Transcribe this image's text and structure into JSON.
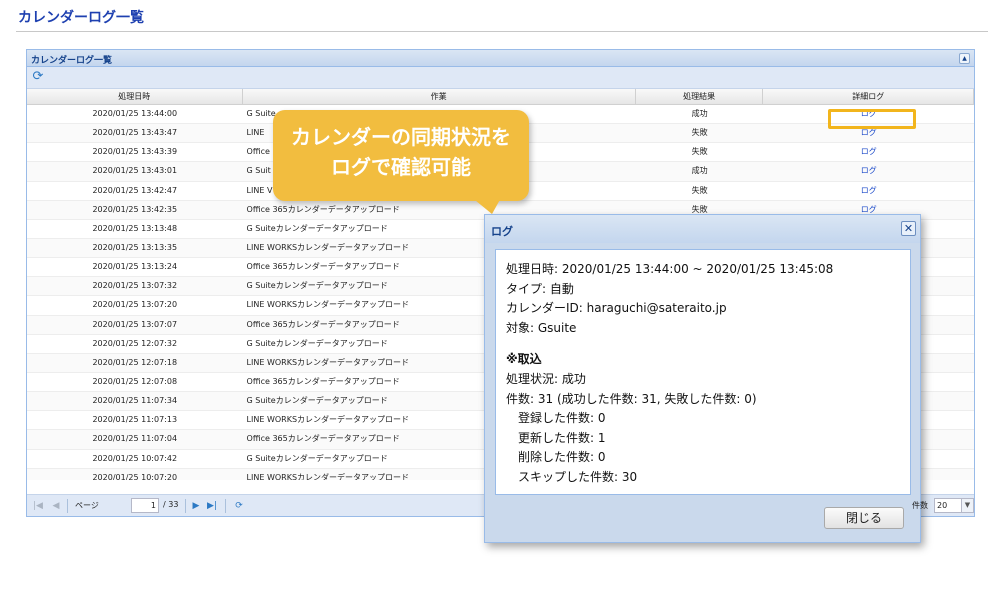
{
  "page": {
    "title": "カレンダーログ一覧"
  },
  "panel": {
    "title": "カレンダーログ一覧"
  },
  "grid": {
    "columns": [
      "処理日時",
      "作業",
      "処理結果",
      "詳細ログ"
    ],
    "rows": [
      {
        "time": "2020/01/25 13:44:00",
        "task": "G Suite",
        "result": "成功",
        "log": "ログ"
      },
      {
        "time": "2020/01/25 13:43:47",
        "task": "LINE",
        "result": "失敗",
        "log": "ログ"
      },
      {
        "time": "2020/01/25 13:43:39",
        "task": "Office",
        "result": "失敗",
        "log": "ログ"
      },
      {
        "time": "2020/01/25 13:43:01",
        "task": "G Suit",
        "result": "成功",
        "log": "ログ"
      },
      {
        "time": "2020/01/25 13:42:47",
        "task": "LINE V",
        "result": "失敗",
        "log": "ログ"
      },
      {
        "time": "2020/01/25 13:42:35",
        "task": "Office 365カレンダーデータアップロード",
        "result": "失敗",
        "log": "ログ"
      },
      {
        "time": "2020/01/25 13:13:48",
        "task": "G Suiteカレンダーデータアップロード",
        "result": "",
        "log": ""
      },
      {
        "time": "2020/01/25 13:13:35",
        "task": "LINE WORKSカレンダーデータアップロード",
        "result": "",
        "log": ""
      },
      {
        "time": "2020/01/25 13:13:24",
        "task": "Office 365カレンダーデータアップロード",
        "result": "",
        "log": ""
      },
      {
        "time": "2020/01/25 13:07:32",
        "task": "G Suiteカレンダーデータアップロード",
        "result": "",
        "log": ""
      },
      {
        "time": "2020/01/25 13:07:20",
        "task": "LINE WORKSカレンダーデータアップロード",
        "result": "",
        "log": ""
      },
      {
        "time": "2020/01/25 13:07:07",
        "task": "Office 365カレンダーデータアップロード",
        "result": "",
        "log": ""
      },
      {
        "time": "2020/01/25 12:07:32",
        "task": "G Suiteカレンダーデータアップロード",
        "result": "",
        "log": ""
      },
      {
        "time": "2020/01/25 12:07:18",
        "task": "LINE WORKSカレンダーデータアップロード",
        "result": "",
        "log": ""
      },
      {
        "time": "2020/01/25 12:07:08",
        "task": "Office 365カレンダーデータアップロード",
        "result": "",
        "log": ""
      },
      {
        "time": "2020/01/25 11:07:34",
        "task": "G Suiteカレンダーデータアップロード",
        "result": "",
        "log": ""
      },
      {
        "time": "2020/01/25 11:07:13",
        "task": "LINE WORKSカレンダーデータアップロード",
        "result": "",
        "log": ""
      },
      {
        "time": "2020/01/25 11:07:04",
        "task": "Office 365カレンダーデータアップロード",
        "result": "",
        "log": ""
      },
      {
        "time": "2020/01/25 10:07:42",
        "task": "G Suiteカレンダーデータアップロード",
        "result": "",
        "log": ""
      },
      {
        "time": "2020/01/25 10:07:20",
        "task": "LINE WORKSカレンダーデータアップロード",
        "result": "",
        "log": ""
      }
    ]
  },
  "pager": {
    "page_label": "ページ",
    "current_page": "1",
    "total_pages": "/ 33",
    "page_size_label": "件数",
    "page_size": "20"
  },
  "callout": {
    "line1": "カレンダーの同期状況を",
    "line2": "ログで確認可能"
  },
  "dialog": {
    "title": "ログ",
    "lines": {
      "time": "処理日時: 2020/01/25 13:44:00 ~ 2020/01/25 13:45:08",
      "type": "タイプ: 自動",
      "calendar_id": "カレンダーID: haraguchi@sateraito.jp",
      "target": "対象: Gsuite",
      "section": "※取込",
      "status": "処理状況: 成功",
      "count": "件数: 31 (成功した件数: 31, 失敗した件数: 0)",
      "registered": "登録した件数: 0",
      "updated": "更新した件数: 1",
      "deleted": "削除した件数: 0",
      "skipped": "スキップした件数: 30"
    },
    "close_button": "閉じる"
  },
  "colors": {
    "accent": "#1e40b0",
    "callout": "#f2bd3f",
    "highlight": "#f2b51c",
    "link": "#1b49c9"
  },
  "icons": {
    "refresh": "refresh-icon",
    "first": "first-page-icon",
    "prev": "prev-page-icon",
    "next": "next-page-icon",
    "last": "last-page-icon",
    "close": "close-icon",
    "collapse": "collapse-icon"
  }
}
